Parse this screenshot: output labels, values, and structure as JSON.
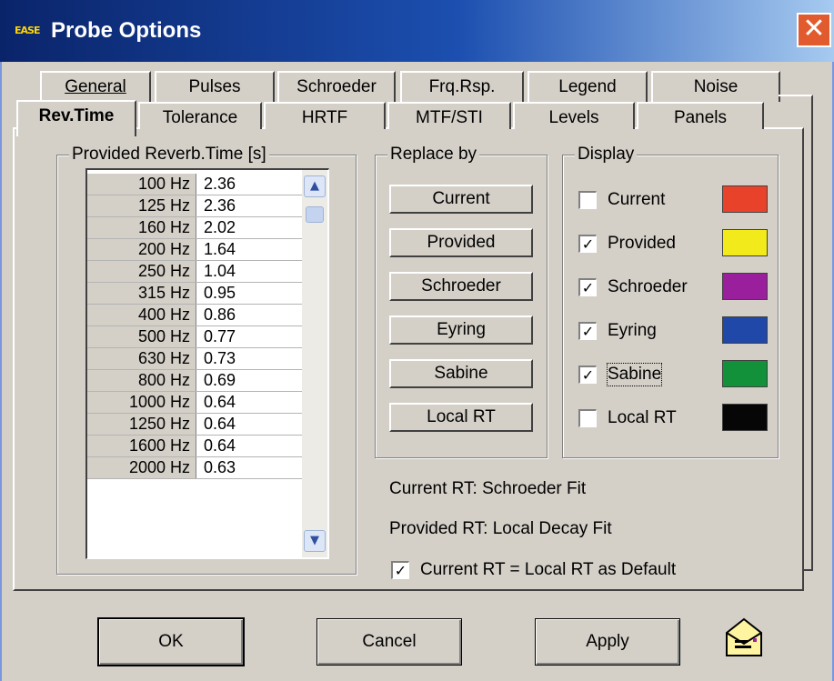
{
  "window": {
    "title": "Probe Options",
    "logo_text": "EASE"
  },
  "tabs_back": [
    {
      "label": "General"
    },
    {
      "label": "Pulses"
    },
    {
      "label": "Schroeder"
    },
    {
      "label": "Frq.Rsp."
    },
    {
      "label": "Legend"
    },
    {
      "label": "Noise"
    }
  ],
  "tabs_front": [
    {
      "label": "Rev.Time",
      "active": true
    },
    {
      "label": "Tolerance"
    },
    {
      "label": "HRTF"
    },
    {
      "label": "MTF/STI"
    },
    {
      "label": "Levels"
    },
    {
      "label": "Panels"
    }
  ],
  "provided": {
    "label": "Provided Reverb.Time [s]",
    "rows": [
      {
        "freq": "100 Hz",
        "value": "2.36"
      },
      {
        "freq": "125 Hz",
        "value": "2.36"
      },
      {
        "freq": "160 Hz",
        "value": "2.02"
      },
      {
        "freq": "200 Hz",
        "value": "1.64"
      },
      {
        "freq": "250 Hz",
        "value": "1.04"
      },
      {
        "freq": "315 Hz",
        "value": "0.95"
      },
      {
        "freq": "400 Hz",
        "value": "0.86"
      },
      {
        "freq": "500 Hz",
        "value": "0.77"
      },
      {
        "freq": "630 Hz",
        "value": "0.73"
      },
      {
        "freq": "800 Hz",
        "value": "0.69"
      },
      {
        "freq": "1000 Hz",
        "value": "0.64"
      },
      {
        "freq": "1250 Hz",
        "value": "0.64"
      },
      {
        "freq": "1600 Hz",
        "value": "0.64"
      },
      {
        "freq": "2000 Hz",
        "value": "0.63"
      }
    ]
  },
  "replace": {
    "label": "Replace by",
    "buttons": [
      "Current",
      "Provided",
      "Schroeder",
      "Eyring",
      "Sabine",
      "Local RT"
    ]
  },
  "display": {
    "label": "Display",
    "items": [
      {
        "label": "Current",
        "checked": false,
        "color": "#e8432a"
      },
      {
        "label": "Provided",
        "checked": true,
        "color": "#f2ea1a"
      },
      {
        "label": "Schroeder",
        "checked": true,
        "color": "#9a1f9c"
      },
      {
        "label": "Eyring",
        "checked": true,
        "color": "#1f48a8"
      },
      {
        "label": "Sabine",
        "checked": true,
        "color": "#13903a"
      },
      {
        "label": "Local RT",
        "checked": false,
        "color": "#060606"
      }
    ]
  },
  "info": {
    "current_rt": "Current RT: Schroeder Fit",
    "provided_rt": "Provided RT: Local Decay Fit",
    "default_checkbox": "Current RT = Local RT as Default",
    "default_checked": true
  },
  "buttons": {
    "ok": "OK",
    "cancel": "Cancel",
    "apply": "Apply"
  },
  "icons": {
    "close": "close-icon",
    "scroll_up": "chevron-up-icon",
    "scroll_down": "chevron-down-icon",
    "mail": "mail-icon"
  }
}
